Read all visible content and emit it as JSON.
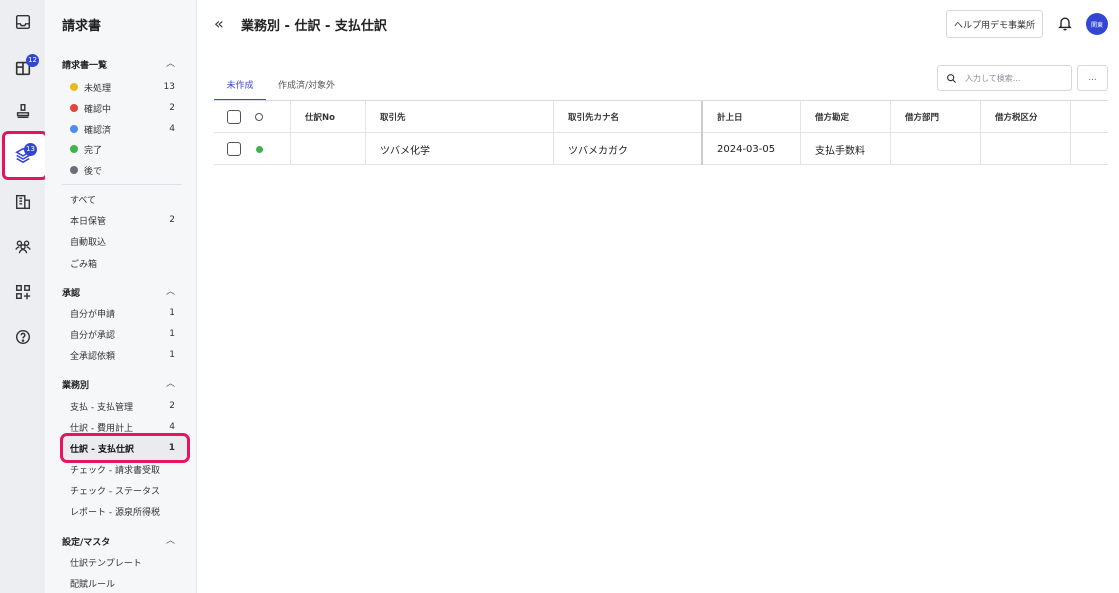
{
  "rail": {
    "badges": {
      "sheet": "12",
      "layers": "13"
    }
  },
  "sidebar": {
    "title": "請求書",
    "section1": {
      "label": "請求書一覧",
      "statuses": [
        {
          "label": "未処理",
          "count": "13",
          "color": "#e8b920"
        },
        {
          "label": "確認中",
          "count": "2",
          "color": "#e0463f"
        },
        {
          "label": "確認済",
          "count": "4",
          "color": "#4d8cf0"
        },
        {
          "label": "完了",
          "count": "",
          "color": "#3cb54a"
        },
        {
          "label": "後で",
          "count": "",
          "color": "#6b6f7a"
        }
      ],
      "filters": [
        {
          "label": "すべて",
          "count": ""
        },
        {
          "label": "本日保管",
          "count": "2"
        },
        {
          "label": "自動取込",
          "count": ""
        },
        {
          "label": "ごみ箱",
          "count": ""
        }
      ]
    },
    "approval": {
      "label": "承認",
      "items": [
        {
          "label": "自分が申請",
          "count": "1"
        },
        {
          "label": "自分が承認",
          "count": "1"
        },
        {
          "label": "全承認依頼",
          "count": "1"
        }
      ]
    },
    "business": {
      "label": "業務別",
      "items": [
        {
          "label": "支払 - 支払管理",
          "count": "2"
        },
        {
          "label": "仕訳 - 費用計上",
          "count": "4"
        },
        {
          "label": "仕訳 - 支払仕訳",
          "count": "1"
        },
        {
          "label": "チェック - 請求書受取",
          "count": ""
        },
        {
          "label": "チェック - ステータス",
          "count": ""
        },
        {
          "label": "レポート - 源泉所得税",
          "count": ""
        }
      ]
    },
    "settings": {
      "label": "設定/マスタ",
      "items": [
        {
          "label": "仕訳テンプレート"
        },
        {
          "label": "配賦ルール"
        }
      ]
    }
  },
  "header": {
    "title": "業務別 - 仕訳 - 支払仕訳",
    "help_button": "ヘルプ用デモ事業所",
    "avatar": "関東"
  },
  "tabs": [
    "未作成",
    "作成済/対象外"
  ],
  "search": {
    "placeholder": "入力して検索..."
  },
  "more_button": "...",
  "table": {
    "columns": [
      "仕訳No",
      "取引先",
      "取引先カナ名",
      "計上日",
      "借方勘定",
      "借方部門",
      "借方税区分"
    ],
    "rows": [
      {
        "no": "",
        "partner": "ツバメ化学",
        "kana": "ツバメカガク",
        "date": "2024-03-05",
        "debit_account": "支払手数料",
        "debit_dept": "",
        "debit_tax": ""
      }
    ]
  },
  "colors": {
    "accent": "#3b4cc0",
    "highlight": "#e6145f",
    "status_ok": "#3cb54a"
  }
}
